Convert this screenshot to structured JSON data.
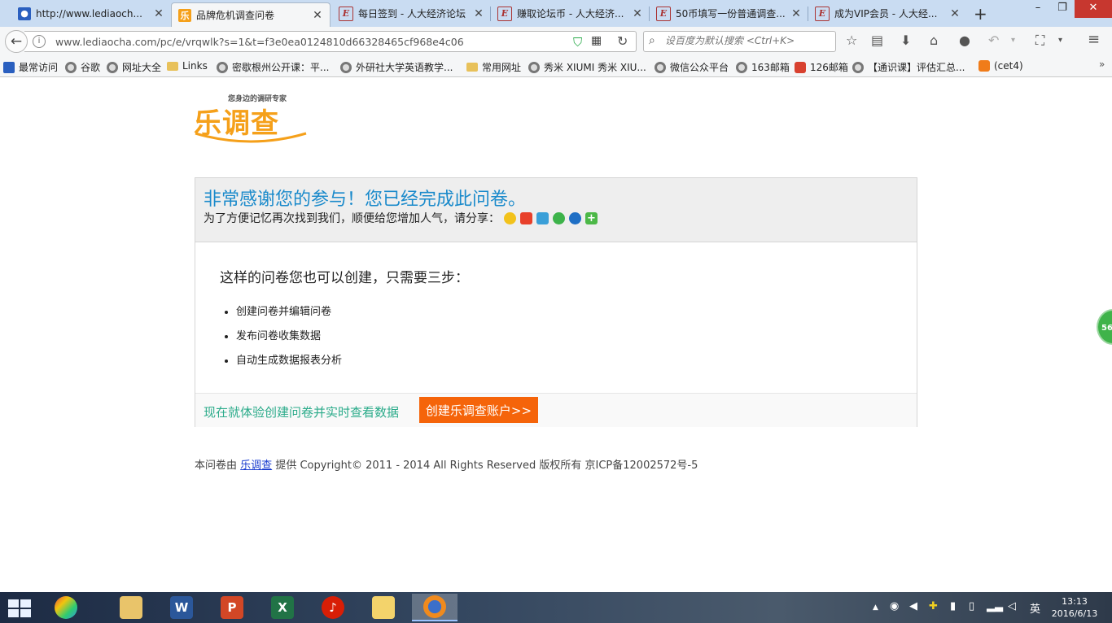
{
  "browser": {
    "tabs": [
      {
        "title": "http://www.lediaoch...",
        "favicon": "paw-icon"
      },
      {
        "title": "品牌危机调查问卷",
        "favicon": "lediaocha-icon",
        "active": true
      },
      {
        "title": "每日签到 - 人大经济论坛",
        "favicon": "e-icon"
      },
      {
        "title": "赚取论坛币 - 人大经济...",
        "favicon": "e-icon"
      },
      {
        "title": "50币填写一份普通调查...",
        "favicon": "e-icon"
      },
      {
        "title": "成为VIP会员 - 人大经...",
        "favicon": "e-icon"
      }
    ],
    "url": "www.lediaocha.com/pc/e/vrqwlk?s=1&t=f3e0ea0124810d66328465cf968e4c06",
    "search_placeholder": "设百度为默认搜索 <Ctrl+K>",
    "bookmarks": [
      {
        "label": "最常访问",
        "icon": "bookmark-blue"
      },
      {
        "label": "谷歌",
        "icon": "globe"
      },
      {
        "label": "网址大全",
        "icon": "globe"
      },
      {
        "label": "Links",
        "icon": "folder"
      },
      {
        "label": "密歇根州公开课：平...",
        "icon": "globe"
      },
      {
        "label": "外研社大学英语教学...",
        "icon": "globe"
      },
      {
        "label": "常用网址",
        "icon": "folder"
      },
      {
        "label": "秀米 XIUMI  秀米 XIU...",
        "icon": "globe"
      },
      {
        "label": "微信公众平台",
        "icon": "globe"
      },
      {
        "label": "163邮箱",
        "icon": "globe"
      },
      {
        "label": "126邮箱",
        "icon": "red"
      },
      {
        "label": "【通识课】评估汇总...",
        "icon": "globe"
      },
      {
        "label": "(cet4)",
        "icon": "orange"
      }
    ]
  },
  "logo": {
    "slogan": "您身边的调研专家",
    "wordmark": "乐调查"
  },
  "page": {
    "thanks_title": "非常感谢您的参与！您已经完成此问卷。",
    "share_prompt": "为了方便记忆再次找到我们，顺便给您增加人气，请分享：",
    "share_icons": [
      "qzone-icon",
      "weibo-icon",
      "tencent-weibo-icon",
      "wechat-icon",
      "renren-icon",
      "more-share-icon"
    ],
    "steps_title": "这样的问卷您也可以创建，只需要三步：",
    "steps": [
      "创建问卷并编辑问卷",
      "发布问卷收集数据",
      "自动生成数据报表分析"
    ],
    "cta_text": "现在就体验创建问卷并实时查看数据",
    "cta_button": "创建乐调查账户>>",
    "footer_prefix": "本问卷由",
    "footer_link": "乐调查",
    "footer_suffix": "提供  Copyright© 2011 - 2014 All Rights Reserved 版权所有  京ICP备12002572号-5",
    "float_badge": "56"
  },
  "taskbar": {
    "apps": [
      "start-menu",
      "color-app",
      "file-explorer",
      "word",
      "powerpoint",
      "excel",
      "netease-music",
      "qq-doodle",
      "firefox"
    ],
    "tray_lang": "英",
    "time": "13:13",
    "date": "2016/6/13"
  },
  "colors": {
    "accent_blue": "#1a8acb",
    "cta_orange": "#f5640a",
    "cta_text_green": "#2bab8a",
    "logo_orange": "#f5a01a"
  }
}
